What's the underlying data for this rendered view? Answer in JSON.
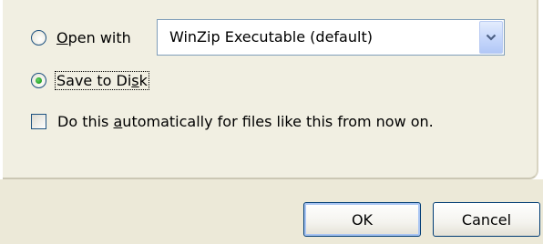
{
  "open_with": {
    "label_prefix": "",
    "label_accel": "O",
    "label_rest": "pen with",
    "selected": false,
    "program": "WinZip Executable (default)",
    "dropdown_icon": "chevron-down-icon"
  },
  "save_to_disk": {
    "label_prefix": "Save to Di",
    "label_accel": "s",
    "label_rest": "k",
    "selected": true
  },
  "auto_option": {
    "label_prefix": "Do this ",
    "label_accel": "a",
    "label_rest": "utomatically for files like this from now on.",
    "checked": false
  },
  "buttons": {
    "ok_label": "OK",
    "cancel_label": "Cancel"
  },
  "colors": {
    "panel_bg": "#f1efe2",
    "footer_bg": "#ece9d8",
    "xp_border_blue": "#003c74",
    "radio_selected_green": "#21a121"
  }
}
